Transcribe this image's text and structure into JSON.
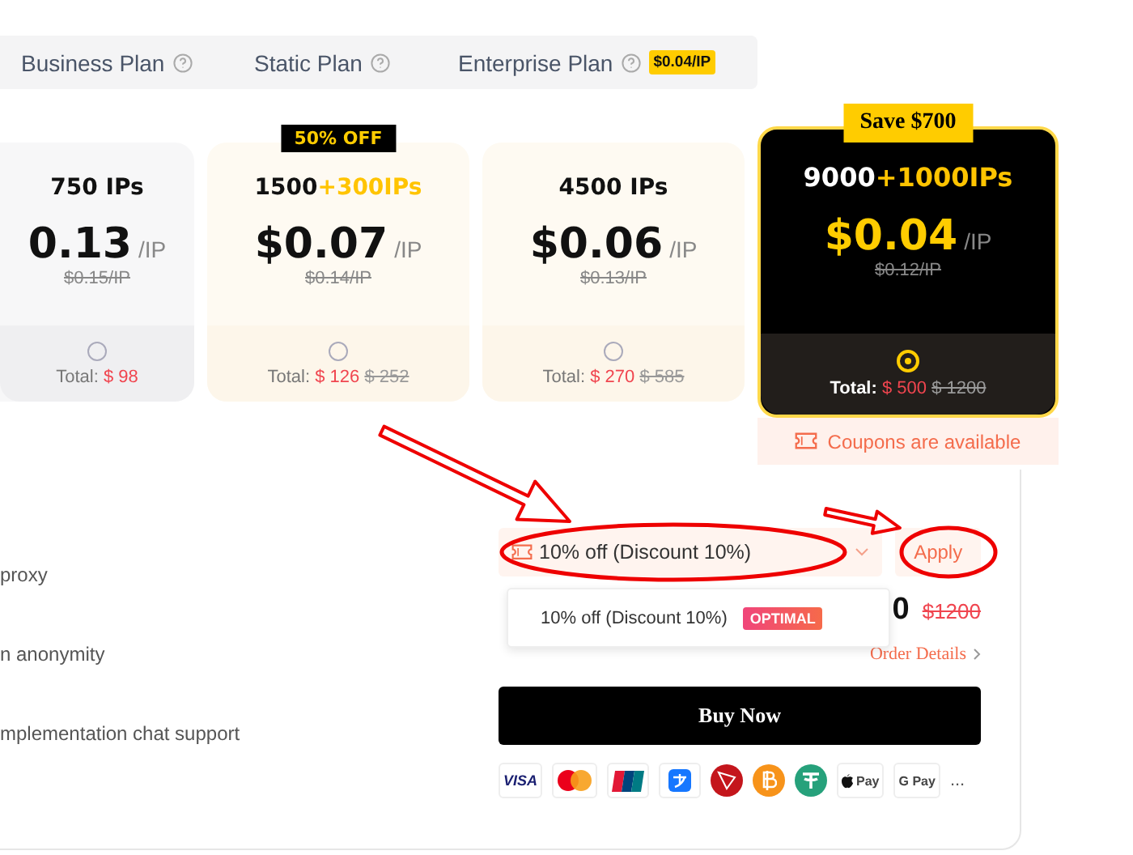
{
  "plan_tabs": [
    {
      "label": "Business Plan",
      "selected": false
    },
    {
      "label": "Static Plan",
      "selected": false
    },
    {
      "label": "Enterprise Plan",
      "selected": false,
      "badge": "$0.04/IP"
    }
  ],
  "packages": [
    {
      "amount": "750 IPs",
      "price": "0.13",
      "unit": "/IP",
      "old_price": "$0.15/IP",
      "total_label": "Total:",
      "total": "$ 98",
      "selected": false,
      "kind": "plain"
    },
    {
      "ribbon": {
        "text": "50% OFF",
        "kind": "dark"
      },
      "amount": "1500",
      "bonus": "+300IPs",
      "price": "$0.07",
      "unit": "/IP",
      "old_price": "$0.14/IP",
      "total_label": "Total:",
      "total": "$ 126",
      "old_total": "$ 252",
      "selected": false,
      "kind": "warm"
    },
    {
      "amount": "4500 IPs",
      "price": "$0.06",
      "unit": "/IP",
      "old_price": "$0.13/IP",
      "total_label": "Total:",
      "total": "$ 270",
      "old_total": "$ 585",
      "selected": false,
      "kind": "warm"
    },
    {
      "ribbon": {
        "text": "Save $700",
        "kind": "gold"
      },
      "amount": "9000",
      "bonus": "+1000IPs",
      "price": "$0.04",
      "unit": "/IP",
      "old_price": "$0.12/IP",
      "total_label": "Total:",
      "total": "$ 500",
      "old_total": "$ 1200",
      "selected": true,
      "kind": "featured",
      "note": "Coupons are available"
    }
  ],
  "features": [
    "proxy",
    "n anonymity",
    "mplementation chat support"
  ],
  "coupon": {
    "value": "10% off (Discount 10%)",
    "apply": "Apply",
    "options": [
      {
        "label": "10% off (Discount 10%)",
        "tag": "OPTIMAL"
      }
    ]
  },
  "price": {
    "amount": "0",
    "old": "$1200"
  },
  "order_details": "Order Details",
  "buy_button": "Buy Now",
  "payments": [
    {
      "kind": "visa",
      "label": "VISA"
    },
    {
      "kind": "mastercard"
    },
    {
      "kind": "unionpay"
    },
    {
      "kind": "alipay"
    },
    {
      "kind": "tron"
    },
    {
      "kind": "bitcoin"
    },
    {
      "kind": "tether"
    },
    {
      "kind": "applepay",
      "label": "Pay"
    },
    {
      "kind": "googlepay",
      "label": "G Pay"
    }
  ],
  "payments_more": "..."
}
